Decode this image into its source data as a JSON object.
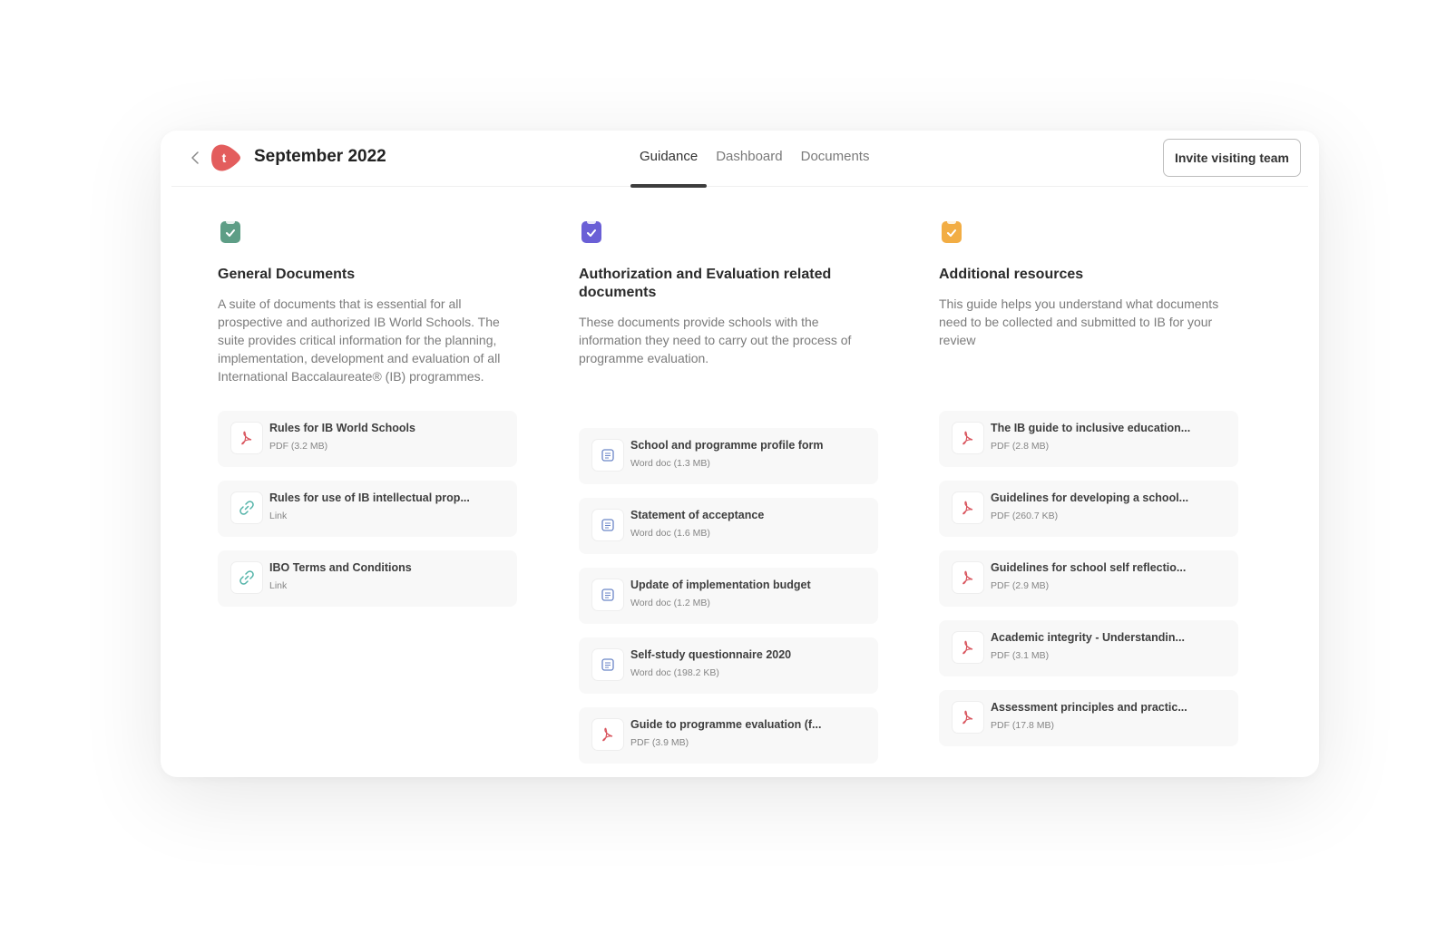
{
  "header": {
    "title": "September 2022",
    "avatar_letter": "t",
    "tabs": [
      {
        "label": "Guidance",
        "active": true
      },
      {
        "label": "Dashboard",
        "active": false
      },
      {
        "label": "Documents",
        "active": false
      }
    ],
    "invite_button": "Invite visiting team"
  },
  "colors": {
    "avatar": "#e35d5d",
    "general": "#5e9e86",
    "authorization": "#6a5fd6",
    "additional": "#f2ad44",
    "pdf_icon": "#d9555e",
    "link_icon": "#52b3a8",
    "doc_icon": "#6b86c8"
  },
  "columns": [
    {
      "title": "General Documents",
      "description": "A suite of documents that is essential for all prospective and authorized IB World Schools. The suite provides critical information for the planning, implementation, development and evaluation of all International Baccalaureate® (IB) programmes.",
      "items": [
        {
          "name": "Rules for IB World Schools",
          "meta": "PDF (3.2 MB)",
          "icon": "pdf-icon"
        },
        {
          "name": "Rules for use of IB intellectual prop...",
          "meta": "Link",
          "icon": "link-icon"
        },
        {
          "name": "IBO Terms and Conditions",
          "meta": "Link",
          "icon": "link-icon"
        }
      ]
    },
    {
      "title": "Authorization and Evaluation related documents",
      "description": "These documents provide schools with the information they need to carry out the process of programme evaluation.",
      "items": [
        {
          "name": "School and programme profile form",
          "meta": "Word doc (1.3 MB)",
          "icon": "doc-icon"
        },
        {
          "name": "Statement of acceptance",
          "meta": "Word doc (1.6 MB)",
          "icon": "doc-icon"
        },
        {
          "name": "Update of implementation budget",
          "meta": "Word doc (1.2 MB)",
          "icon": "doc-icon"
        },
        {
          "name": "Self-study questionnaire 2020",
          "meta": "Word doc (198.2 KB)",
          "icon": "doc-icon"
        },
        {
          "name": "Guide to programme evaluation (f...",
          "meta": "PDF (3.9 MB)",
          "icon": "pdf-icon"
        }
      ]
    },
    {
      "title": "Additional resources",
      "description": "This guide helps you understand what documents need to be collected and submitted to IB for your review",
      "items": [
        {
          "name": "The IB guide to inclusive education...",
          "meta": "PDF (2.8 MB)",
          "icon": "pdf-icon"
        },
        {
          "name": "Guidelines for developing a school...",
          "meta": "PDF (260.7 KB)",
          "icon": "pdf-icon"
        },
        {
          "name": "Guidelines for school self reflectio...",
          "meta": "PDF (2.9 MB)",
          "icon": "pdf-icon"
        },
        {
          "name": "Academic integrity - Understandin...",
          "meta": "PDF (3.1 MB)",
          "icon": "pdf-icon"
        },
        {
          "name": "Assessment principles and practic...",
          "meta": "PDF (17.8 MB)",
          "icon": "pdf-icon"
        }
      ]
    }
  ]
}
